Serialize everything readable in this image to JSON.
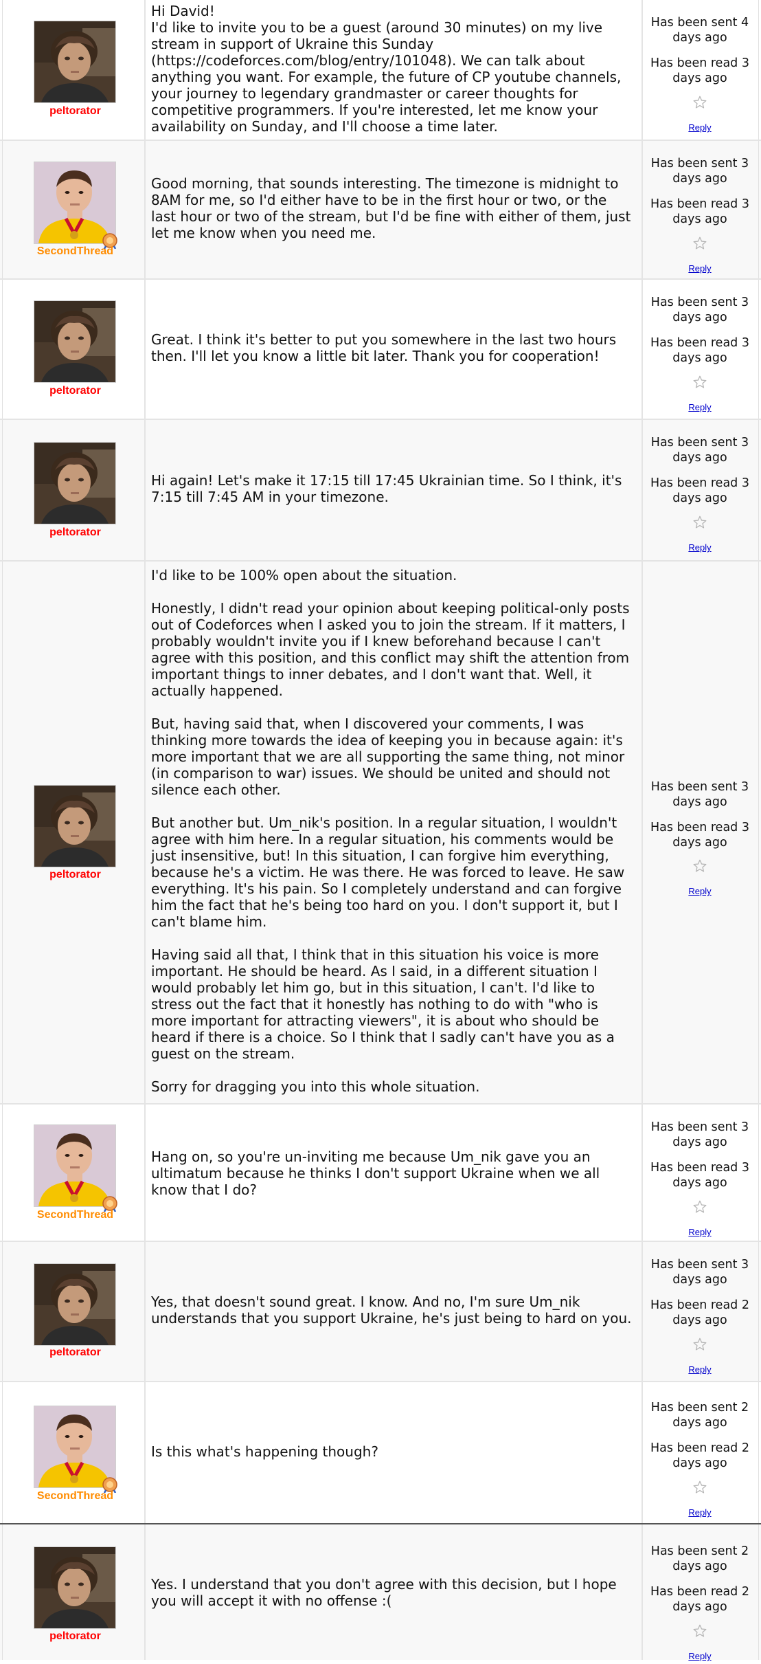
{
  "users": {
    "peltorator": {
      "handle": "peltorator",
      "color": "#ff0000"
    },
    "secondthread": {
      "handle": "SecondThread",
      "color": "#ff8c00"
    }
  },
  "reply_label": "Reply",
  "messages": [
    {
      "author": "peltorator",
      "text": "Hi David!\nI'd like to invite you to be a guest (around 30 minutes) on my live stream in support of Ukraine this Sunday (https://codeforces.com/blog/entry/101048). We can talk about anything you want. For example, the future of CP youtube channels, your journey to legendary grandmaster or career thoughts for competitive programmers. If you're interested, let me know your availability on Sunday, and I'll choose a time later.",
      "sent": "Has been sent 4 days ago",
      "read": "Has been read 3 days ago"
    },
    {
      "author": "SecondThread",
      "text": "Good morning, that sounds interesting. The timezone is midnight to 8AM for me, so I'd either have to be in the first hour or two, or the last hour or two of the stream, but I'd be fine with either of them, just let me know when you need me.",
      "sent": "Has been sent 3 days ago",
      "read": "Has been read 3 days ago"
    },
    {
      "author": "peltorator",
      "text": "Great. I think it's better to put you somewhere in the last two hours then. I'll let you know a little bit later. Thank you for cooperation!",
      "sent": "Has been sent 3 days ago",
      "read": "Has been read 3 days ago"
    },
    {
      "author": "peltorator",
      "text": "Hi again! Let's make it 17:15 till 17:45 Ukrainian time. So I think, it's 7:15 till 7:45 AM in your timezone.",
      "sent": "Has been sent 3 days ago",
      "read": "Has been read 3 days ago"
    },
    {
      "author": "peltorator",
      "text": "I'd like to be 100% open about the situation.\n\nHonestly, I didn't read your opinion about keeping political-only posts out of Codeforces when I asked you to join the stream. If it matters, I probably wouldn't invite you if I knew beforehand because I can't agree with this position, and this conflict may shift the attention from important things to inner debates, and I don't want that. Well, it actually happened.\n\nBut, having said that, when I discovered your comments, I was thinking more towards the idea of keeping you in because again: it's more important that we are all supporting the same thing, not minor (in comparison to war) issues. We should be united and should not silence each other.\n\nBut another but. Um_nik's position. In a regular situation, I wouldn't agree with him here. In a regular situation, his comments would be just insensitive, but! In this situation, I can forgive him everything, because he's a victim. He was there. He was forced to leave. He saw everything. It's his pain. So I completely understand and can forgive him the fact that he's being too hard on you. I don't support it, but I can't blame him.\n\nHaving said all that, I think that in this situation his voice is more important. He should be heard. As I said, in a different situation I would probably let him go, but in this situation, I can't. I'd like to stress out the fact that it honestly has nothing to do with \"who is more important for attracting viewers\", it is about who should be heard if there is a choice. So I think that I sadly can't have you as a guest on the stream.\n\nSorry for dragging you into this whole situation.",
      "sent": "Has been sent 3 days ago",
      "read": "Has been read 3 days ago"
    },
    {
      "author": "SecondThread",
      "text": "Hang on, so you're un-inviting me because Um_nik gave you an ultimatum because he thinks I don't support Ukraine when we all know that I do?",
      "sent": "Has been sent 3 days ago",
      "read": "Has been read 3 days ago"
    },
    {
      "author": "peltorator",
      "text": "Yes, that doesn't sound great. I know. And no, I'm sure Um_nik understands that you support Ukraine, he's just being to hard on you.",
      "sent": "Has been sent 3 days ago",
      "read": "Has been read 2 days ago"
    },
    {
      "author": "SecondThread",
      "text": "Is this what's happening though?",
      "sent": "Has been sent 2 days ago",
      "read": "Has been read 2 days ago"
    },
    {
      "author": "peltorator",
      "text": "Yes. I understand that you don't agree with this decision, but I hope you will accept it with no offense :(",
      "sent": "Has been sent 2 days ago",
      "read": "Has been read 2 days ago"
    }
  ]
}
